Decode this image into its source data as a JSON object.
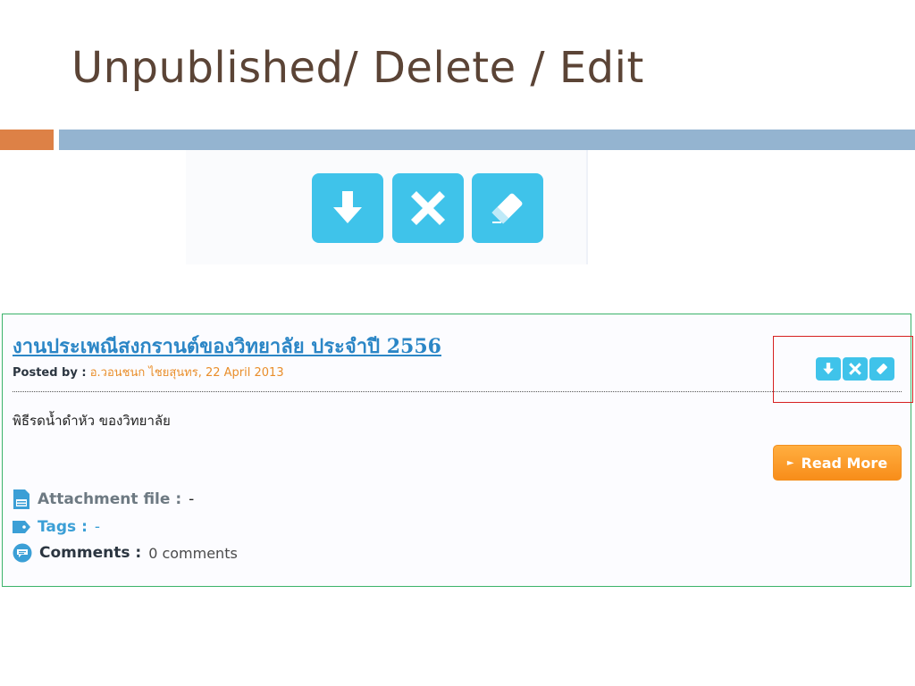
{
  "slide": {
    "title": "Unpublished/ Delete / Edit",
    "colors": {
      "title": "#5b4436",
      "accent_orange": "#dd8146",
      "accent_blue": "#94b4d0"
    }
  },
  "zoom_icons": [
    {
      "name": "unpublish-icon",
      "shape": "down-arrow"
    },
    {
      "name": "delete-icon",
      "shape": "x"
    },
    {
      "name": "edit-icon",
      "shape": "eraser"
    }
  ],
  "post": {
    "title": "งานประเพณีสงกรานต์ของวิทยาลัย ประจำปี 2556",
    "posted_by_label": "Posted by :",
    "posted_by_value": "อ.วอนชนก ไชยสุนทร, 22 April 2013",
    "excerpt": "พิธีรดน้ำดำหัว ของวิทยาลัย",
    "read_more_label": "Read More",
    "attachment_label": "Attachment file :",
    "attachment_value": "-",
    "tags_label": "Tags :",
    "tags_value": "-",
    "comments_label": "Comments :",
    "comments_value": "0 comments",
    "colors": {
      "icon_blue": "#3fc3ea",
      "title_link": "#2b86c6",
      "author": "#e98e2b",
      "read_more": "#f88d1a",
      "highlight": "#d62121"
    }
  }
}
